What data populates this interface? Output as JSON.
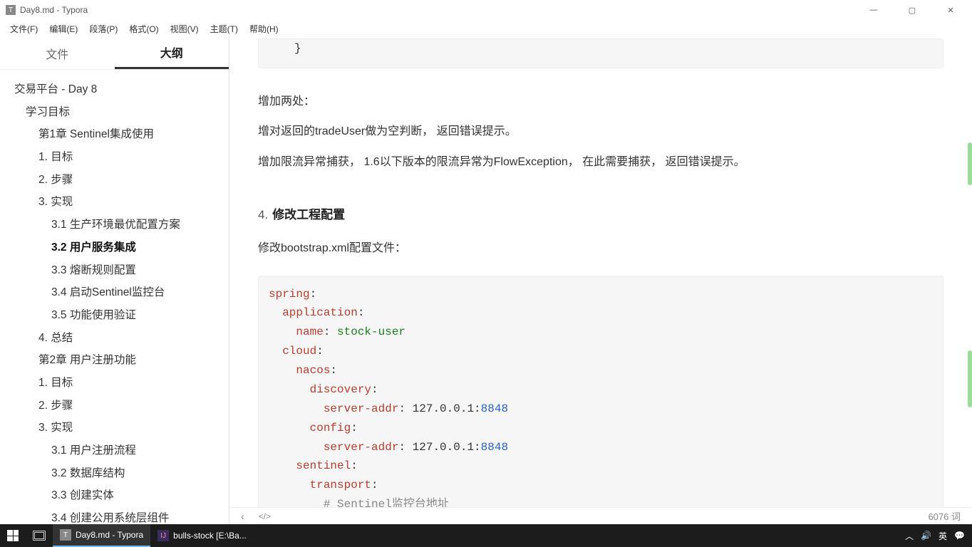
{
  "window": {
    "title": "Day8.md - Typora",
    "app_icon_letter": "T"
  },
  "menu": [
    "文件(F)",
    "编辑(E)",
    "段落(P)",
    "格式(O)",
    "视图(V)",
    "主题(T)",
    "帮助(H)"
  ],
  "sidebar": {
    "tabs": {
      "files": "文件",
      "outline": "大纲",
      "active": "outline"
    },
    "outline": [
      {
        "lvl": 1,
        "label": "交易平台 - Day 8"
      },
      {
        "lvl": 2,
        "label": "学习目标"
      },
      {
        "lvl": 3,
        "label": "第1章 Sentinel集成使用"
      },
      {
        "lvl": 3,
        "label": "1. 目标"
      },
      {
        "lvl": 3,
        "label": "2. 步骤"
      },
      {
        "lvl": 3,
        "label": "3. 实现"
      },
      {
        "lvl": 4,
        "label": "3.1 生产环境最优配置方案"
      },
      {
        "lvl": 4,
        "label": "3.2 用户服务集成",
        "active": true
      },
      {
        "lvl": 4,
        "label": "3.3 熔断规则配置"
      },
      {
        "lvl": 4,
        "label": "3.4 启动Sentinel监控台"
      },
      {
        "lvl": 4,
        "label": "3.5 功能使用验证"
      },
      {
        "lvl": 3,
        "label": "4. 总结"
      },
      {
        "lvl": 3,
        "label": "第2章 用户注册功能"
      },
      {
        "lvl": 3,
        "label": "1. 目标"
      },
      {
        "lvl": 3,
        "label": "2. 步骤"
      },
      {
        "lvl": 3,
        "label": "3. 实现"
      },
      {
        "lvl": 4,
        "label": "3.1 用户注册流程"
      },
      {
        "lvl": 4,
        "label": "3.2 数据库结构"
      },
      {
        "lvl": 4,
        "label": "3.3 创建实体"
      },
      {
        "lvl": 4,
        "label": "3.4 创建公用系统层组件"
      }
    ]
  },
  "content": {
    "code_trail": "}",
    "para1": "增加两处：",
    "para2": "增对返回的tradeUser做为空判断， 返回错误提示。",
    "para3": "增加限流异常捕获， 1.6以下版本的限流异常为FlowException， 在此需要捕获， 返回错误提示。",
    "heading_num": "4.",
    "heading_text": "修改工程配置",
    "para4": "修改bootstrap.xml配置文件：",
    "yaml": {
      "l1": "spring",
      "l2": "application",
      "l3k": "name",
      "l3v": "stock-user",
      "l4": "cloud",
      "l5": "nacos",
      "l6": "discovery",
      "l7k": "server-addr",
      "l7v1": "127.0.0.1:",
      "l7v2": "8848",
      "l8": "config",
      "l9k": "server-addr",
      "l9v1": "127.0.0.1:",
      "l9v2": "8848",
      "l10": "sentinel",
      "l11": "transport",
      "l12": "# Sentinel监控台地址"
    }
  },
  "statusbar": {
    "word_count": "6076 词"
  },
  "taskbar": {
    "typora": "Day8.md - Typora",
    "idea": "bulls-stock [E:\\Ba...",
    "ime": "英"
  }
}
